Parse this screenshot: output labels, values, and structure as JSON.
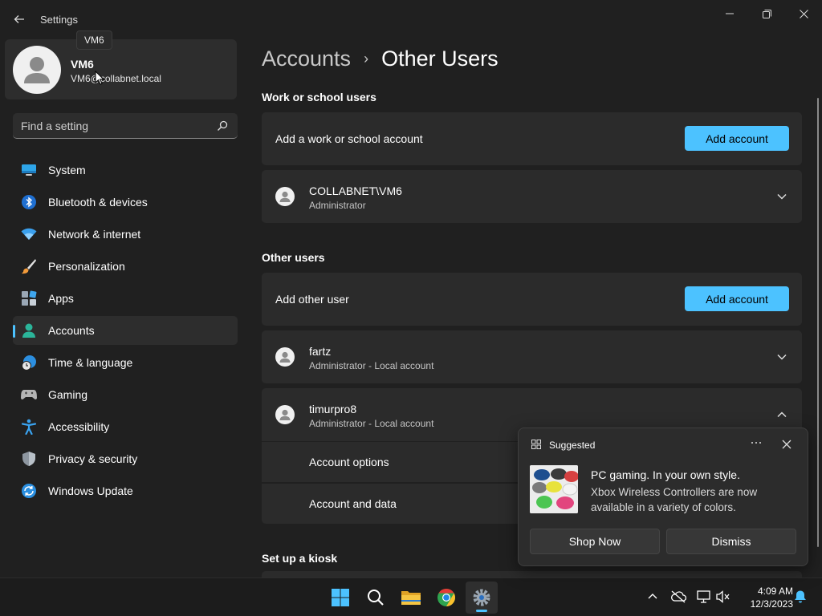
{
  "window": {
    "title": "Settings",
    "tooltip": "VM6"
  },
  "profile": {
    "name": "VM6",
    "email": "VM6@collabnet.local"
  },
  "search": {
    "placeholder": "Find a setting"
  },
  "sidebar": {
    "items": [
      {
        "label": "System",
        "icon": "monitor-icon"
      },
      {
        "label": "Bluetooth & devices",
        "icon": "bluetooth-icon"
      },
      {
        "label": "Network & internet",
        "icon": "wifi-icon"
      },
      {
        "label": "Personalization",
        "icon": "paintbrush-icon"
      },
      {
        "label": "Apps",
        "icon": "apps-icon"
      },
      {
        "label": "Accounts",
        "icon": "person-icon",
        "active": true
      },
      {
        "label": "Time & language",
        "icon": "globe-clock-icon"
      },
      {
        "label": "Gaming",
        "icon": "gamepad-icon"
      },
      {
        "label": "Accessibility",
        "icon": "accessibility-icon"
      },
      {
        "label": "Privacy & security",
        "icon": "shield-icon"
      },
      {
        "label": "Windows Update",
        "icon": "sync-icon"
      }
    ]
  },
  "main": {
    "breadcrumb_parent": "Accounts",
    "breadcrumb_sep": "›",
    "page_title": "Other Users",
    "work_section": {
      "title": "Work or school users",
      "add_label": "Add a work or school account",
      "add_button": "Add account",
      "users": [
        {
          "name": "COLLABNET\\VM6",
          "role": "Administrator"
        }
      ]
    },
    "other_section": {
      "title": "Other users",
      "add_label": "Add other user",
      "add_button": "Add account",
      "users": [
        {
          "name": "fartz",
          "role": "Administrator - Local account",
          "expanded": false
        },
        {
          "name": "timurpro8",
          "role": "Administrator - Local account",
          "expanded": true
        }
      ],
      "expanded_options": [
        "Account options",
        "Account and data"
      ]
    },
    "kiosk_section": {
      "title": "Set up a kiosk"
    }
  },
  "notification": {
    "app": "Suggested",
    "title": "PC gaming. In your own style.",
    "body": "Xbox Wireless Controllers are now available in a variety of colors.",
    "primary_button": "Shop Now",
    "secondary_button": "Dismiss"
  },
  "taskbar": {
    "apps": [
      "start-icon",
      "search-icon",
      "file-explorer-icon",
      "chrome-icon",
      "settings-icon"
    ],
    "time": "4:09 AM",
    "date": "12/3/2023"
  },
  "colors": {
    "accent": "#4cc2ff",
    "background": "#202020",
    "card": "#2b2b2b"
  }
}
